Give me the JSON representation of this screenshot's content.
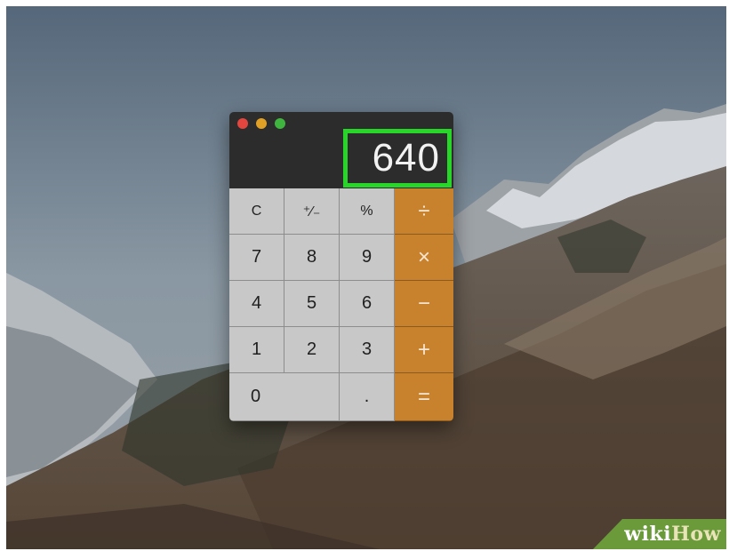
{
  "calculator": {
    "display_value": "640",
    "keys": {
      "clear": "C",
      "sign": "⁺∕₋",
      "percent": "%",
      "divide": "÷",
      "seven": "7",
      "eight": "8",
      "nine": "9",
      "multiply": "×",
      "four": "4",
      "five": "5",
      "six": "6",
      "minus": "−",
      "one": "1",
      "two": "2",
      "three": "3",
      "plus": "+",
      "zero": "0",
      "decimal": ".",
      "equals": "="
    },
    "colors": {
      "operator_key": "#c8822e",
      "number_key": "#c8c8c8",
      "window": "#2c2c2c",
      "display_highlight": "#27d629"
    }
  },
  "watermark": {
    "part1": "wiki",
    "part2": "How"
  }
}
